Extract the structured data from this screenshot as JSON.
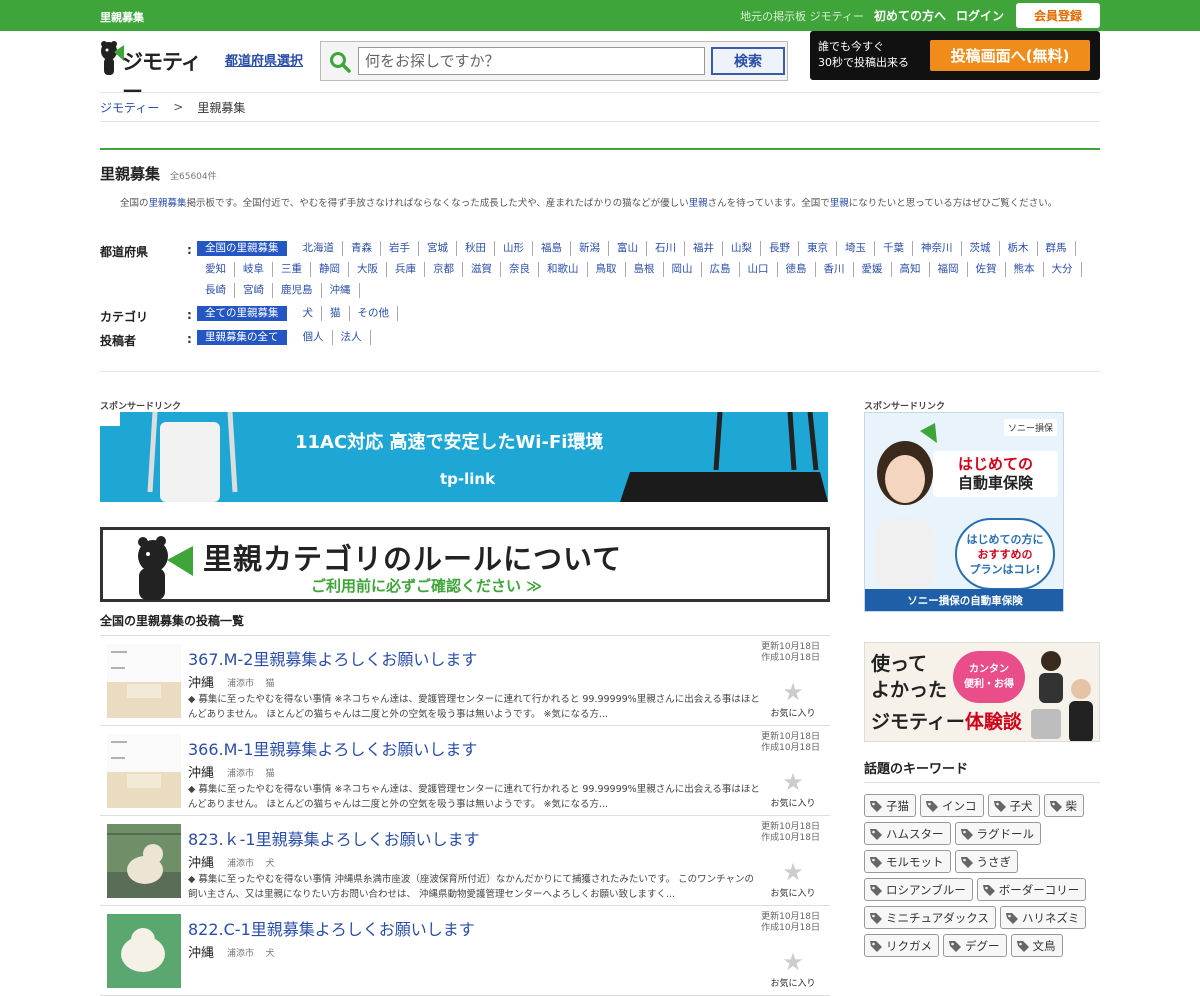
{
  "topbar": {
    "title": "里親募集",
    "local_text": "地元の掲示板 ジモティー",
    "first_time": "初めての方へ",
    "login": "ログイン",
    "register": "会員登録"
  },
  "header": {
    "logo_text": "ジモティー",
    "pref_link": "都道府県選択",
    "search_placeholder": "何をお探しですか？",
    "search_button": "検索",
    "post_line1": "誰でも今すぐ",
    "post_line2": "30秒で投稿出来る",
    "post_button": "投稿画面へ(無料)"
  },
  "breadcrumb": {
    "home": "ジモティー",
    "sep": ">",
    "current": "里親募集"
  },
  "page": {
    "title": "里親募集",
    "count": "全65604件",
    "desc_1": "全国の",
    "desc_link1": "里親募集",
    "desc_2": "掲示板です。全国付近で、やむを得ず手放さなければならなくなった成長した犬や、産まれたばかりの猫などが優しい",
    "desc_link2": "里親",
    "desc_3": "さんを待っています。全国で",
    "desc_link3": "里親",
    "desc_4": "になりたいと思っている方はぜひご覧ください。"
  },
  "filters": {
    "pref": {
      "label": "都道府県",
      "colon": ":",
      "active": "全国の里親募集",
      "items": [
        "北海道",
        "青森",
        "岩手",
        "宮城",
        "秋田",
        "山形",
        "福島",
        "新潟",
        "富山",
        "石川",
        "福井",
        "山梨",
        "長野",
        "東京",
        "埼玉",
        "千葉",
        "神奈川",
        "茨城",
        "栃木",
        "群馬",
        "愛知",
        "岐阜",
        "三重",
        "静岡",
        "大阪",
        "兵庫",
        "京都",
        "滋賀",
        "奈良",
        "和歌山",
        "鳥取",
        "島根",
        "岡山",
        "広島",
        "山口",
        "徳島",
        "香川",
        "愛媛",
        "高知",
        "福岡",
        "佐賀",
        "熊本",
        "大分",
        "長崎",
        "宮崎",
        "鹿児島",
        "沖縄"
      ]
    },
    "category": {
      "label": "カテゴリ",
      "colon": ":",
      "active": "全ての里親募集",
      "items": [
        "犬",
        "猫",
        "その他"
      ]
    },
    "poster": {
      "label": "投稿者",
      "colon": ":",
      "active": "里親募集の全て",
      "items": [
        "個人",
        "法人"
      ]
    }
  },
  "ads": {
    "sponsor_label": "スポンサードリンク",
    "main_banner_text": "11AC対応 高速で安定したWi-Fi環境",
    "main_banner_brand": "tp-link",
    "side_brand": "ソニー損保",
    "side_head_1": "はじめての",
    "side_head_2": "自動車保険",
    "side_bubble_1": "はじめての方に",
    "side_bubble_2": "おすすめの",
    "side_bubble_3": "プランはコレ!",
    "side_foot": "ソニー損保の自動車保険"
  },
  "rule_banner": {
    "title": "里親カテゴリのルールについて",
    "sub": "ご利用前に必ずご確認ください ≫"
  },
  "list": {
    "title": "全国の里親募集の投稿一覧",
    "fav_label": "お気に入り",
    "items": [
      {
        "title": "367.M-2里親募集よろしくお願いします",
        "area": "沖縄",
        "city": "浦添市",
        "category": "猫",
        "updated": "更新10月18日",
        "created": "作成10月18日",
        "body": "◆ 募集に至ったやむを得ない事情 ※ネコちゃん達は、愛護管理センターに連れて行かれると 99.99999%里親さんに出会える事はほとんどありません。 ほとんどの猫ちゃんは二度と外の空気を吸う事は無いようです。 ※気になる方...",
        "thumb_type": "cat"
      },
      {
        "title": "366.M-1里親募集よろしくお願いします",
        "area": "沖縄",
        "city": "浦添市",
        "category": "猫",
        "updated": "更新10月18日",
        "created": "作成10月18日",
        "body": "◆ 募集に至ったやむを得ない事情 ※ネコちゃん達は、愛護管理センターに連れて行かれると 99.99999%里親さんに出会える事はほとんどありません。 ほとんどの猫ちゃんは二度と外の空気を吸う事は無いようです。 ※気になる方...",
        "thumb_type": "cat"
      },
      {
        "title": "823.ｋ-1里親募集よろしくお願いします",
        "area": "沖縄",
        "city": "浦添市",
        "category": "犬",
        "updated": "更新10月18日",
        "created": "作成10月18日",
        "body": "◆ 募集に至ったやむを得ない事情 沖縄県糸満市座波（座波保育所付近）なかんだかりにて捕獲されたみたいです。 このワンチャンの飼い主さん、又は里親になりたい方お問い合わせは、 沖縄県動物愛護管理センターへよろしくお願い致しますく...",
        "thumb_type": "dog"
      },
      {
        "title": "822.C-1里親募集よろしくお願いします",
        "area": "沖縄",
        "city": "浦添市",
        "category": "犬",
        "updated": "更新10月18日",
        "created": "作成10月18日",
        "body": "",
        "thumb_type": "dog2"
      }
    ]
  },
  "right": {
    "exp_line1": "使って",
    "exp_line2": "よかった",
    "exp_badge_1": "カンタン",
    "exp_badge_2": "便利・お得",
    "exp_brand": "ジモティー",
    "exp_suffix": "体験談",
    "keywords_title": "話題のキーワード",
    "keywords": [
      "子猫",
      "インコ",
      "子犬",
      "柴",
      "ハムスター",
      "ラグドール",
      "モルモット",
      "うさぎ",
      "ロシアンブルー",
      "ボーダーコリー",
      "ミニチュアダックス",
      "ハリネズミ",
      "リクガメ",
      "デグー",
      "文鳥"
    ]
  },
  "colors": {
    "green": "#3fa53a",
    "link_blue": "#2a4ea8",
    "active_blue": "#2456c4",
    "orange": "#f08c1a"
  }
}
